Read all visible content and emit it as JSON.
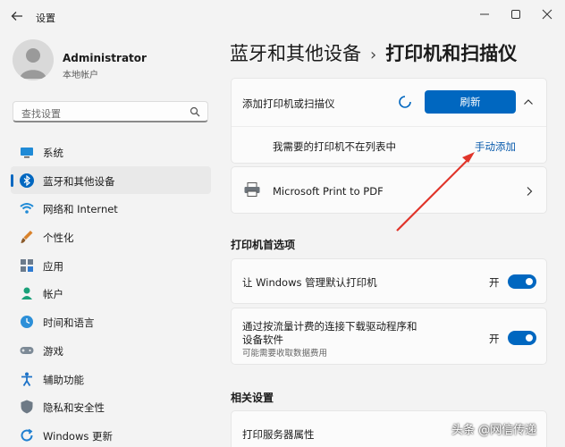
{
  "window": {
    "title": "设置",
    "controls": [
      "minimize",
      "maximize",
      "close"
    ]
  },
  "profile": {
    "name": "Administrator",
    "account_type": "本地帐户"
  },
  "search": {
    "placeholder": "查找设置"
  },
  "sidebar": {
    "items": [
      {
        "label": "系统",
        "icon": "monitor-icon",
        "active": false
      },
      {
        "label": "蓝牙和其他设备",
        "icon": "bluetooth-icon",
        "active": true
      },
      {
        "label": "网络和 Internet",
        "icon": "wifi-icon",
        "active": false
      },
      {
        "label": "个性化",
        "icon": "brush-icon",
        "active": false
      },
      {
        "label": "应用",
        "icon": "apps-icon",
        "active": false
      },
      {
        "label": "帐户",
        "icon": "person-icon",
        "active": false
      },
      {
        "label": "时间和语言",
        "icon": "globe-clock-icon",
        "active": false
      },
      {
        "label": "游戏",
        "icon": "gamepad-icon",
        "active": false
      },
      {
        "label": "辅助功能",
        "icon": "accessibility-icon",
        "active": false
      },
      {
        "label": "隐私和安全性",
        "icon": "shield-icon",
        "active": false
      },
      {
        "label": "Windows 更新",
        "icon": "update-icon",
        "active": false
      }
    ]
  },
  "breadcrumb": {
    "parent": "蓝牙和其他设备",
    "separator": "›",
    "current": "打印机和扫描仪"
  },
  "add_printer": {
    "label": "添加打印机或扫描仪",
    "refresh_label": "刷新",
    "not_listed_label": "我需要的打印机不在列表中",
    "manual_add_label": "手动添加"
  },
  "printers": [
    {
      "name": "Microsoft Print to PDF"
    }
  ],
  "preferences": {
    "title": "打印机首选项",
    "items": [
      {
        "label": "让 Windows 管理默认打印机",
        "sublabel": "",
        "state": "开",
        "on": true
      },
      {
        "label": "通过按流量计费的连接下载驱动程序和设备软件",
        "sublabel": "可能需要收取数据费用",
        "state": "开",
        "on": true
      }
    ]
  },
  "related": {
    "title": "相关设置",
    "items": [
      {
        "label": "打印服务器属性"
      }
    ]
  },
  "watermark": "头条 @网信传递",
  "colors": {
    "accent": "#0067c0",
    "annotation_arrow": "#e0352b",
    "background": "#f3f3f3",
    "card": "#fbfbfb"
  }
}
